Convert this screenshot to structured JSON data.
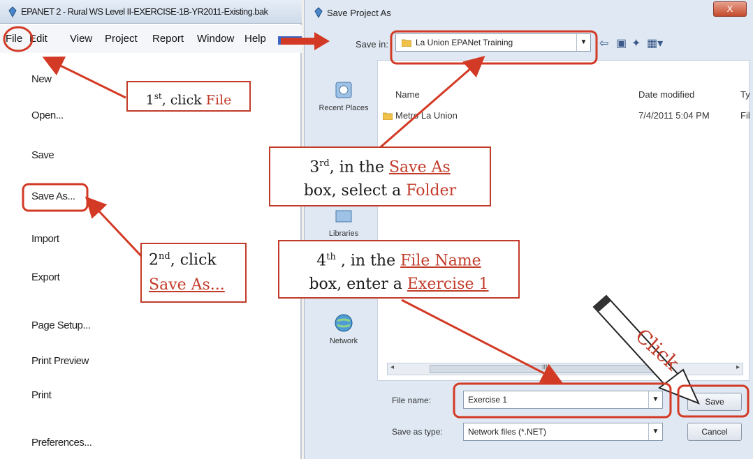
{
  "epanet": {
    "title": "EPANET 2 - Rural WS Level II-EXERCISE-1B-YR2011-Existing.bak",
    "menu": [
      "File",
      "Edit",
      "View",
      "Project",
      "Report",
      "Window",
      "Help"
    ],
    "file_menu": [
      "New",
      "Open...",
      "Save",
      "Save As...",
      "Import",
      "Export",
      "Page Setup...",
      "Print Preview",
      "Print",
      "Preferences..."
    ]
  },
  "dialog": {
    "title": "Save Project As",
    "close_symbol": "X",
    "save_in_label": "Save in:",
    "save_in_value": "La Union EPANet Training",
    "places": [
      "Recent Places",
      "Libraries",
      "Network"
    ],
    "columns": {
      "name": "Name",
      "date": "Date modified",
      "type": "Ty"
    },
    "files": [
      {
        "name": "Metro La Union",
        "date": "7/4/2011 5:04 PM",
        "type": "Fil"
      }
    ],
    "scroll_mark": "III",
    "file_name_label": "File name:",
    "file_name_value": "Exercise 1",
    "save_type_label": "Save as type:",
    "save_type_value": "Network files (*.NET)",
    "save_button": "Save",
    "cancel_button": "Cancel"
  },
  "annotations": {
    "step1": {
      "prefix": "1",
      "sup": "st",
      "text": ", click ",
      "hl": "File"
    },
    "step2": {
      "prefix": "2",
      "sup": "nd",
      "text": ", click",
      "hl": "Save As..."
    },
    "step3": {
      "prefix": "3",
      "sup": "rd",
      "text": ", in the ",
      "hl": "Save As",
      "line2": "box, select a ",
      "hl2": "Folder"
    },
    "step4": {
      "prefix": "4",
      "sup": "th",
      "text": " , in the ",
      "hl": "File Name",
      "line2": "box, enter a ",
      "hl2": "Exercise 1"
    },
    "click_label": "Click"
  },
  "colors": {
    "annotation_red": "#d33a25",
    "callout_red_text": "#c23b2a",
    "menubar_blue": "#3a66c4"
  }
}
